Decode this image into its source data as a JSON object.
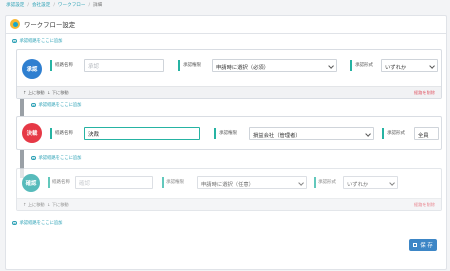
{
  "breadcrumb": {
    "items": [
      "承認設定",
      "会社設定",
      "ワークフロー",
      "詳細"
    ]
  },
  "panel": {
    "title": "ワークフロー設定"
  },
  "add_step_label": "承認経路をここに追加",
  "steps": [
    {
      "badge": "承認",
      "badge_color": "#2f7fd0",
      "name_label": "経路名称",
      "name_placeholder": "承認",
      "name_value": "",
      "approver_label": "承認権限",
      "approver_value": "申請時に選択（必須）",
      "format_label": "承認形式",
      "format_value": "いずれか",
      "move_up": "上に移動",
      "move_down": "下に移動",
      "delete": "経路を削除"
    },
    {
      "badge": "決裁",
      "badge_color": "#e63946",
      "name_label": "経路名称",
      "name_placeholder": "",
      "name_value": "決裁",
      "approver_label": "承認権限",
      "approver_value": "損益会社（管理者）",
      "format_label": "承認形式",
      "format_value": "全員"
    },
    {
      "badge": "確認",
      "badge_color": "#17a2a2",
      "name_label": "経路名称",
      "name_placeholder": "確認",
      "name_value": "",
      "approver_label": "承認権限",
      "approver_value": "申請時に選択（任意）",
      "format_label": "承認形式",
      "format_value": "いずれか",
      "move_up": "上に移動",
      "move_down": "下に移動",
      "delete": "経路を削除"
    }
  ],
  "save_label": "保 存"
}
